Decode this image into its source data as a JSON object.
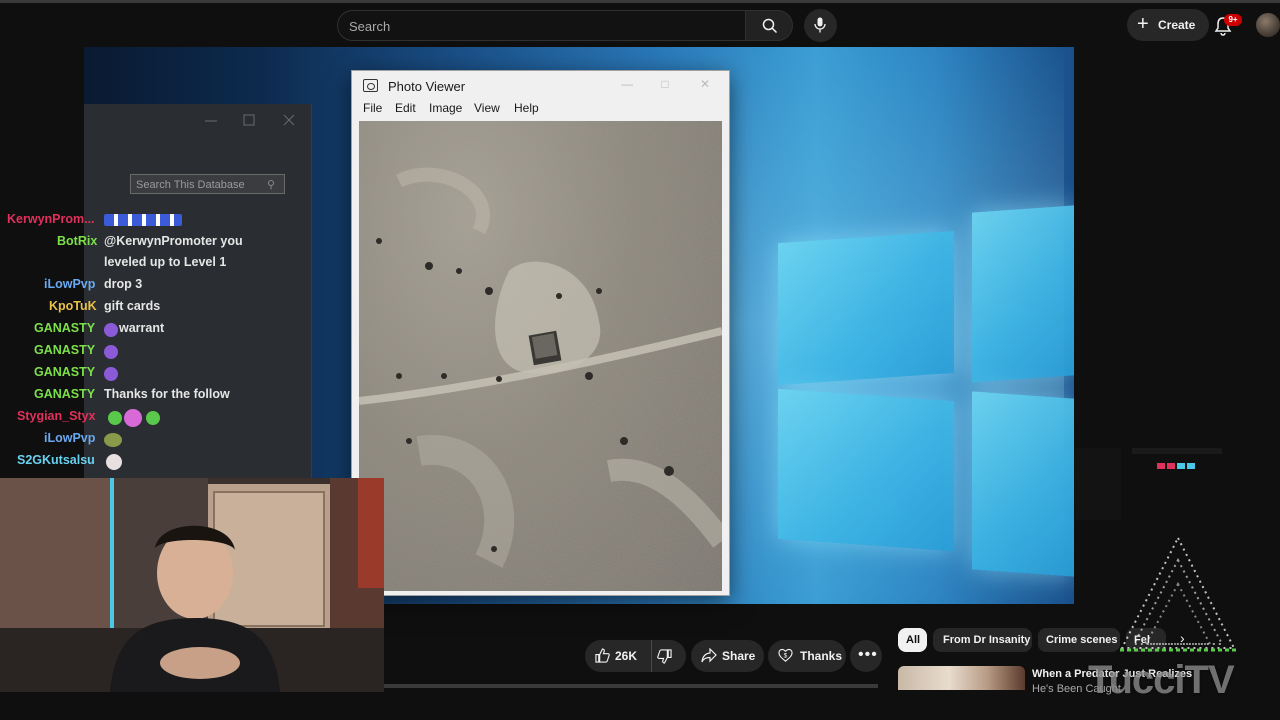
{
  "header": {
    "search_placeholder": "Search",
    "create_label": "Create",
    "notification_count": "9+"
  },
  "db_window": {
    "search_placeholder": "Search This Database"
  },
  "photo_viewer": {
    "title": "Photo Viewer",
    "menu": [
      "File",
      "Edit",
      "Image",
      "View",
      "Help"
    ]
  },
  "chat": [
    {
      "user": "KerwynProm...",
      "message": "",
      "color": "#e0315c"
    },
    {
      "user": "BotRix",
      "message": "@KerwynPromoter you",
      "color": "#7ce04a"
    },
    {
      "user": "",
      "message": "leveled up to Level 1",
      "color": "#7ce04a"
    },
    {
      "user": "iLowPvp",
      "message": "drop 3",
      "color": "#6aa8f0"
    },
    {
      "user": "KpoTuK",
      "message": "gift cards",
      "color": "#e8c14a"
    },
    {
      "user": "GANASTY",
      "message": "warrant",
      "color": "#7ce04a"
    },
    {
      "user": "GANASTY",
      "message": "",
      "color": "#7ce04a"
    },
    {
      "user": "GANASTY",
      "message": "",
      "color": "#7ce04a"
    },
    {
      "user": "GANASTY",
      "message": "Thanks for the follow",
      "color": "#7ce04a"
    },
    {
      "user": "Stygian_Styx",
      "message": "",
      "color": "#e0315c"
    },
    {
      "user": "iLowPvp",
      "message": "",
      "color": "#6aa8f0"
    },
    {
      "user": "S2GKutsalsu",
      "message": "",
      "color": "#6ad0f0"
    }
  ],
  "actions": {
    "likes": "26K",
    "share_label": "Share",
    "thanks_label": "Thanks"
  },
  "chips": [
    "All",
    "From Dr Insanity",
    "Crime scenes",
    "Fel"
  ],
  "recommendation": {
    "title": "When a Predator Just Realizes",
    "subtitle": "He's Been Caught"
  },
  "watermark": "TucciTV"
}
